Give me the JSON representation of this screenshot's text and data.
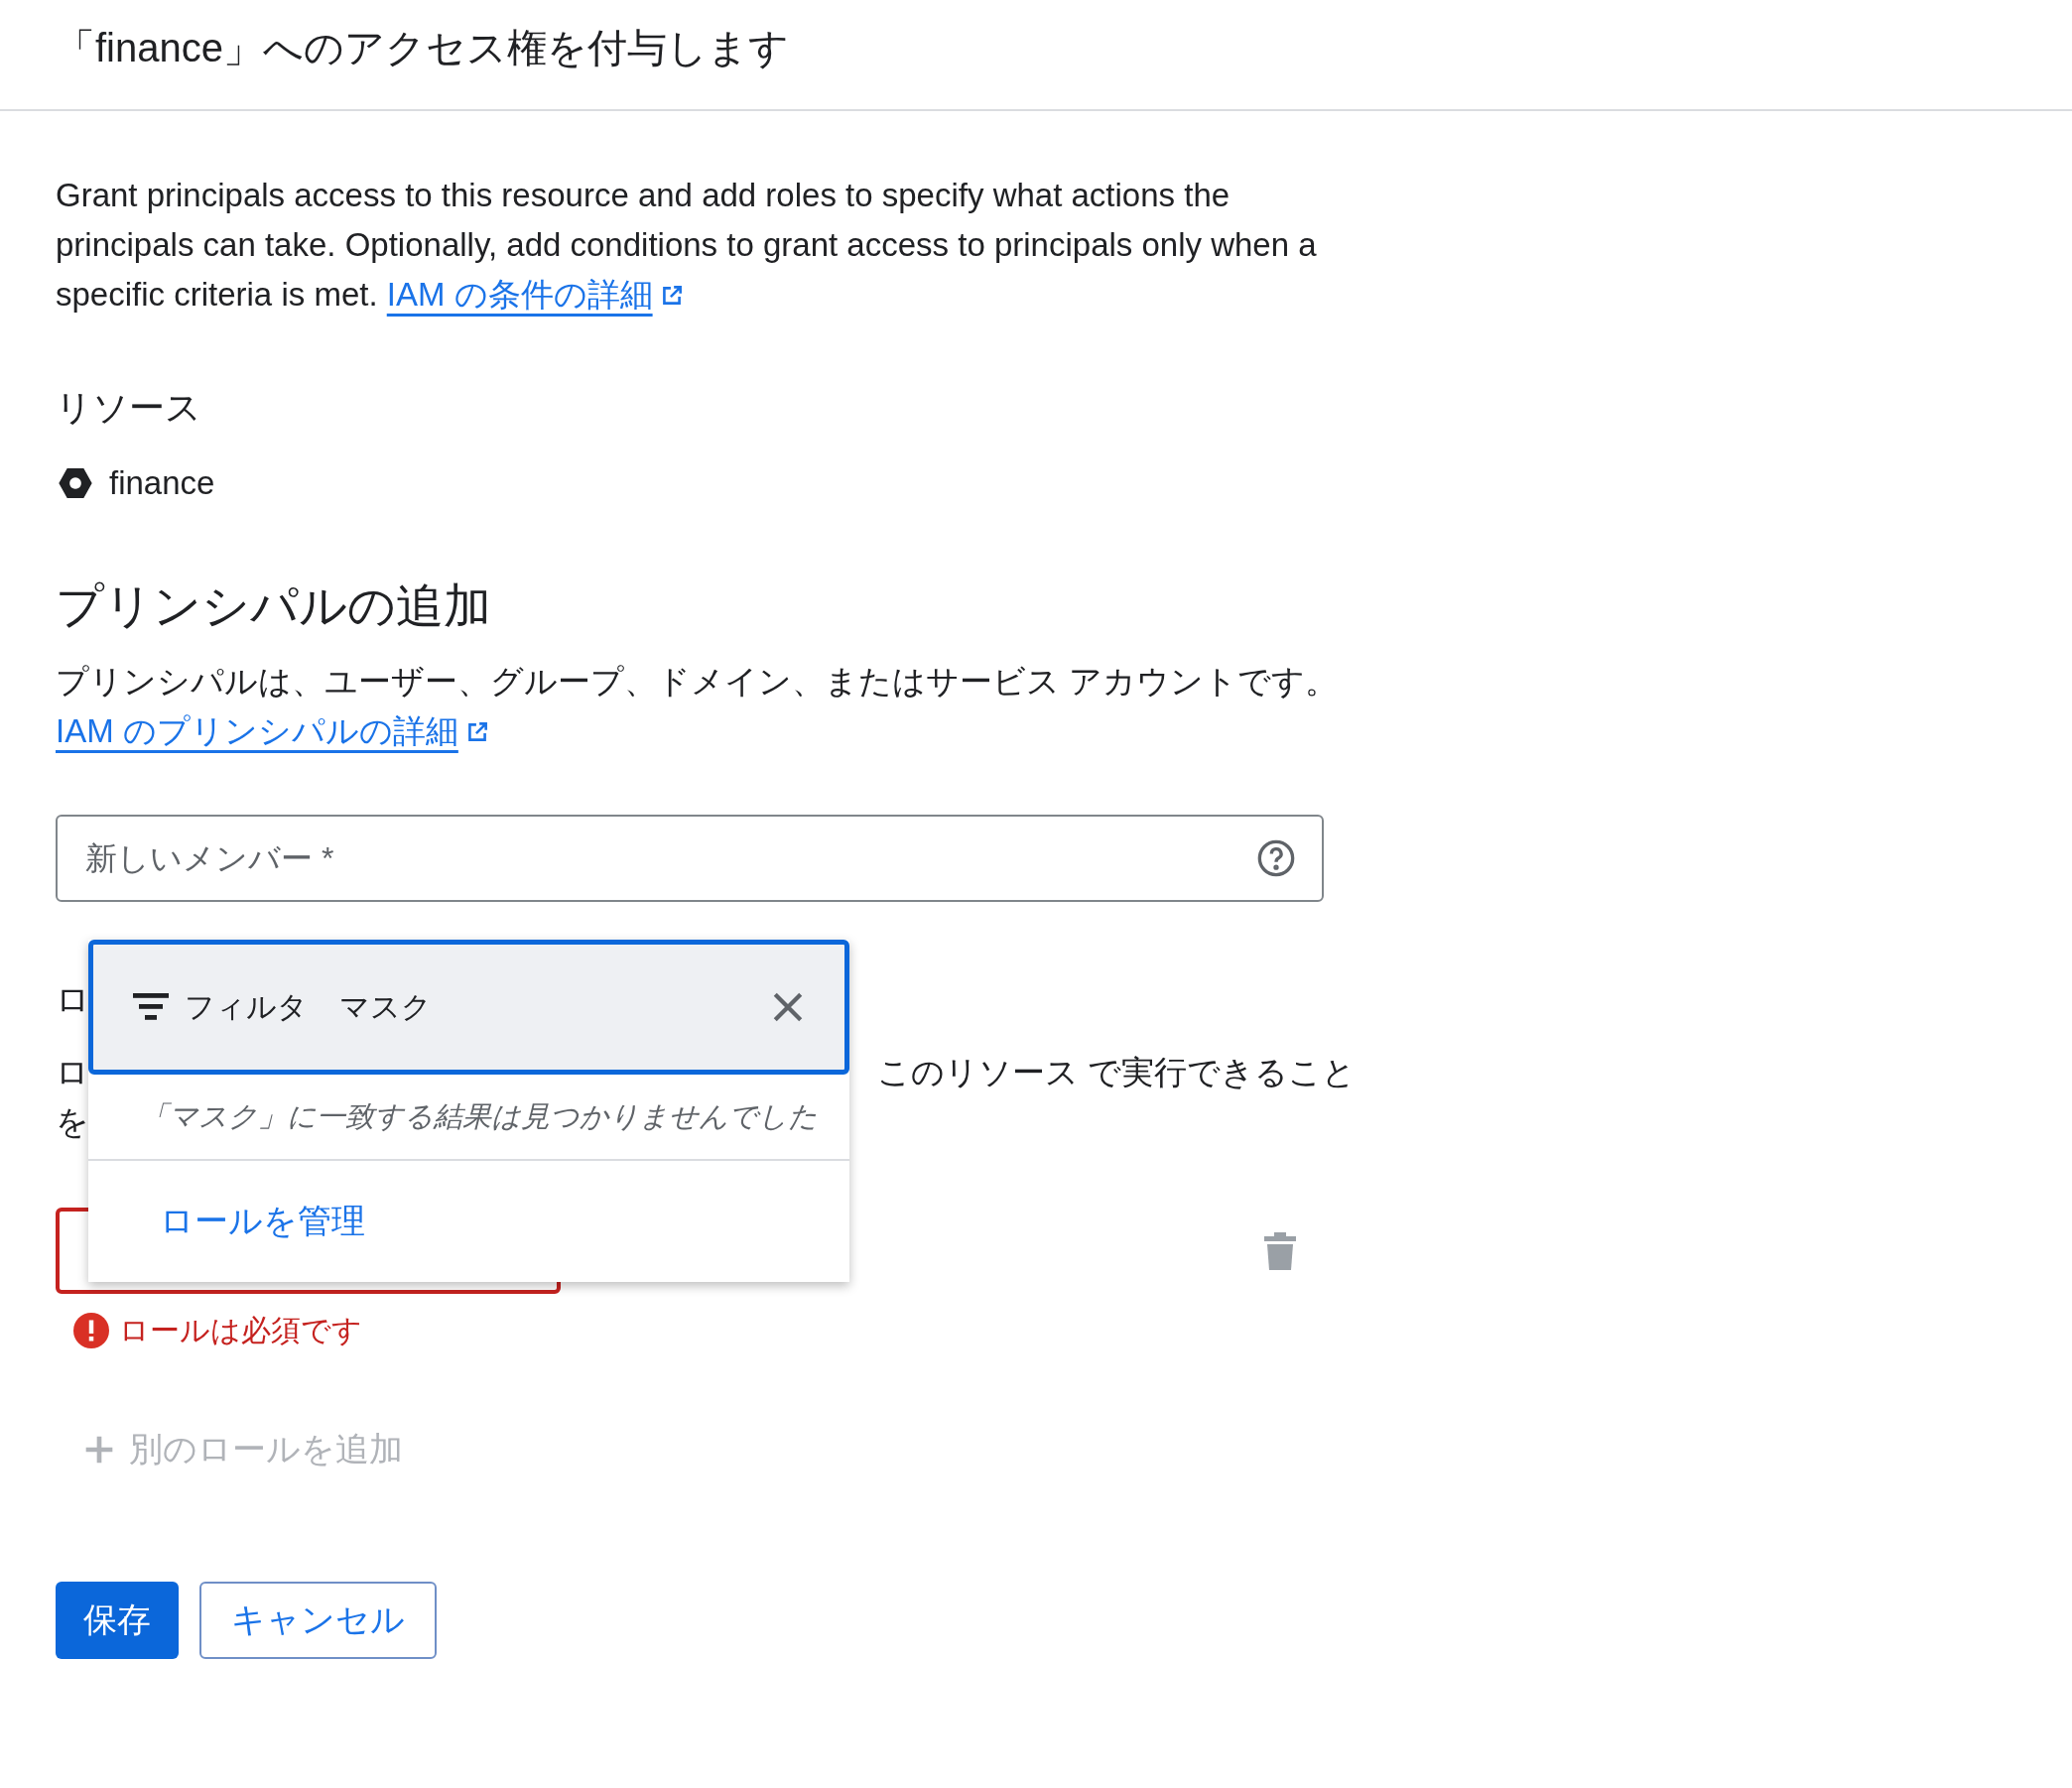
{
  "header": {
    "title": "「finance」へのアクセス権を付与します"
  },
  "intro": {
    "text": "Grant principals access to this resource and add roles to specify what actions the principals can take. Optionally, add conditions to grant access to principals only when a specific criteria is met.",
    "link": "IAM の条件の詳細"
  },
  "resource": {
    "label": "リソース",
    "name": "finance"
  },
  "principals": {
    "heading": "プリンシパルの追加",
    "text": "プリンシパルは、ユーザー、グループ、ドメイン、またはサービス アカウントです。",
    "link": "IAM のプリンシパルの詳細",
    "field": {
      "placeholder": "新しいメンバー *"
    }
  },
  "roles": {
    "heading": "ロ",
    "text_left": [
      "ロ",
      "を"
    ],
    "text_right": "このリソース で実行できること",
    "role_field": {
      "error": true
    },
    "error_text": "ロールは必須です",
    "add_role": {
      "label": "別のロールを追加",
      "disabled": true
    }
  },
  "dropdown": {
    "filter_label": "フィルタ",
    "filter_value": "マスク",
    "no_results": "「マスク」に一致する結果は見つかりませんでした",
    "manage_link": "ロールを管理"
  },
  "buttons": [
    {
      "label": "保存",
      "kind": "primary"
    },
    {
      "label": "キャンセル",
      "kind": "secondary"
    }
  ]
}
